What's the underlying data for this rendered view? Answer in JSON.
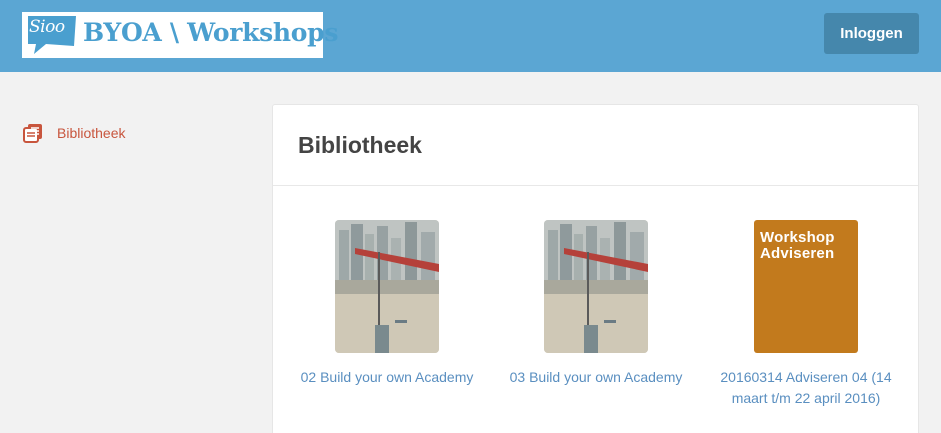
{
  "header": {
    "logo_badge": "Sioo",
    "logo_title": "BYOA \\ Workshops",
    "login_label": "Inloggen"
  },
  "sidebar": {
    "items": [
      {
        "label": "Bibliotheek",
        "icon": "library-icon"
      }
    ]
  },
  "main": {
    "title": "Bibliotheek",
    "items": [
      {
        "title": "02 Build your own Academy",
        "thumbnail": "city-crane-photo"
      },
      {
        "title": "03 Build your own Academy",
        "thumbnail": "city-crane-photo"
      },
      {
        "title": "20160314 Adviseren 04 (14 maart t/m 22 april 2016)",
        "thumbnail_text": "Workshop Adviseren"
      }
    ]
  },
  "colors": {
    "header_bg": "#5ba6d3",
    "login_button": "#4587ac",
    "accent_red": "#c8553d",
    "link_blue": "#5a8fc0",
    "thumb_orange": "#c27a1d"
  }
}
